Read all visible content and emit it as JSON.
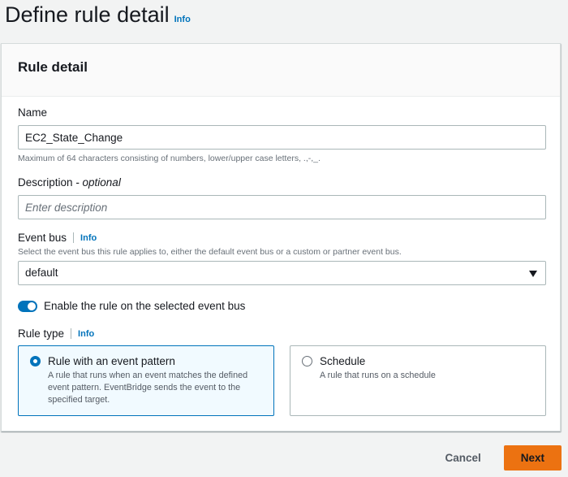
{
  "page": {
    "title": "Define rule detail",
    "info_label": "Info"
  },
  "panel": {
    "title": "Rule detail"
  },
  "name_field": {
    "label": "Name",
    "value": "EC2_State_Change",
    "hint": "Maximum of 64 characters consisting of numbers, lower/upper case letters, .,-,_."
  },
  "description_field": {
    "label": "Description",
    "optional": " - optional",
    "placeholder": "Enter description"
  },
  "event_bus": {
    "label": "Event bus",
    "info_label": "Info",
    "hint": "Select the event bus this rule applies to, either the default event bus or a custom or partner event bus.",
    "selected": "default"
  },
  "enable_toggle": {
    "label": "Enable the rule on the selected event bus",
    "on": true
  },
  "rule_type": {
    "label": "Rule type",
    "info_label": "Info",
    "options": [
      {
        "title": "Rule with an event pattern",
        "description": "A rule that runs when an event matches the defined event pattern. EventBridge sends the event to the specified target.",
        "selected": true
      },
      {
        "title": "Schedule",
        "description": "A rule that runs on a schedule",
        "selected": false
      }
    ]
  },
  "footer": {
    "cancel_label": "Cancel",
    "next_label": "Next"
  },
  "colors": {
    "accent": "#0073bb",
    "primary_button": "#ec7211"
  }
}
